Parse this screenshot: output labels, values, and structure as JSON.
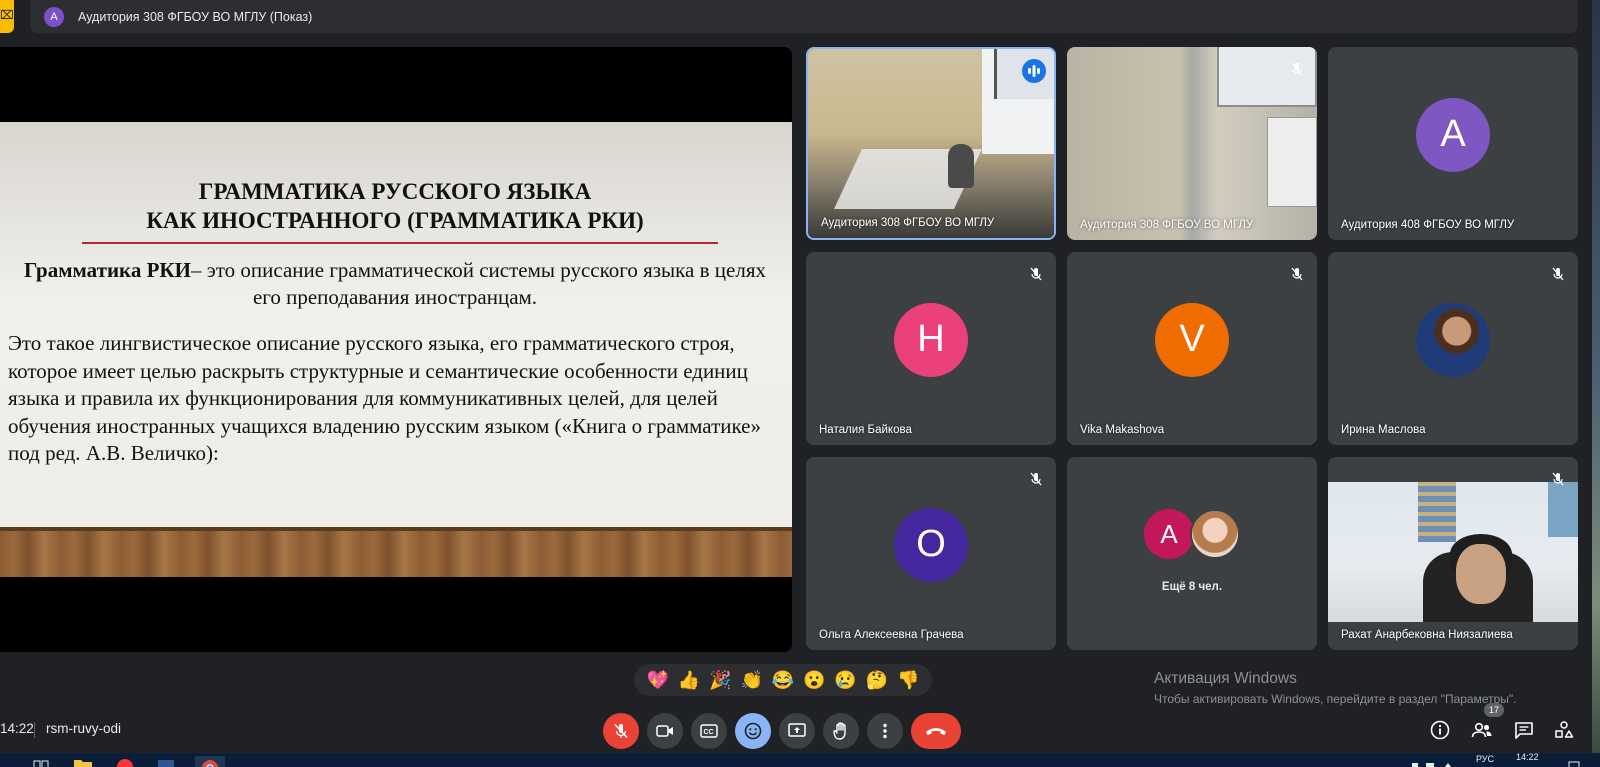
{
  "top_bar": {
    "presenter_initial": "A",
    "presentation_title": "Аудитория 308 ФГБОУ ВО МГЛУ (Показ)"
  },
  "slide": {
    "title_line1": "ГРАММАТИКА РУССКОГО ЯЗЫКА",
    "title_line2": "КАК ИНОСТРАННОГО (ГРАММАТИКА РКИ)",
    "definition_term": "Грамматика РКИ",
    "definition_text": "– это описание грамматической системы русского языка в целях его преподавания иностранцам.",
    "body": "Это такое лингвистическое описание русского языка, его грамматического строя, которое имеет целью раскрыть структурные и семантические особенности единиц языка и правила их функционирования для коммуникативных целей, для целей обучения иностранных учащихся владению русским языком («Книга о грамматике» под ред. А.В. Величко):"
  },
  "tiles": [
    {
      "name": "Аудитория 308 ФГБОУ ВО МГЛУ",
      "type": "video",
      "speaking": true
    },
    {
      "name": "Аудитория 308 ФГБОУ ВО МГЛУ",
      "type": "video",
      "muted": true
    },
    {
      "name": "Аудитория 408 ФГБОУ ВО МГЛУ",
      "initial": "A",
      "color": "#7e57c2"
    },
    {
      "name": "Наталия Байкова",
      "initial": "Н",
      "color": "#ec407a",
      "muted": true
    },
    {
      "name": "Vika Makashova",
      "initial": "V",
      "color": "#ef6c00",
      "muted": true
    },
    {
      "name": "Ирина Маслова",
      "type": "photo",
      "muted": true
    },
    {
      "name": "Ольга Алексеевна Грачева",
      "initial": "О",
      "color": "#4527a0",
      "muted": true
    },
    {
      "group_initial": "A",
      "more_label": "Ещё 8 чел."
    },
    {
      "name": "Рахат Анарбековна Ниязалиева",
      "type": "video",
      "muted": true
    }
  ],
  "reactions": [
    "💖",
    "👍",
    "🎉",
    "👏",
    "😂",
    "😮",
    "😢",
    "🤔",
    "👎"
  ],
  "watermark": {
    "line1": "Активация Windows",
    "line2": "Чтобы активировать Windows, перейдите в раздел \"Параметры\"."
  },
  "bottom_bar": {
    "time": "14:22",
    "meeting_code": "rsm-ruvy-odi",
    "participants_count": "17"
  },
  "controls": [
    "mic-off-icon",
    "camera-icon",
    "captions-icon",
    "emoji-icon",
    "present-icon",
    "raise-hand-icon",
    "more-icon",
    "end-call-icon"
  ],
  "right_controls": [
    "info-icon",
    "people-icon",
    "chat-icon",
    "activities-icon"
  ],
  "taskbar": {
    "language": "РУС",
    "clock": "14:22"
  },
  "colors": {
    "background": "#202124",
    "tile": "#3c4043",
    "accent_blue": "#8ab4f8",
    "danger_red": "#ea4335"
  }
}
